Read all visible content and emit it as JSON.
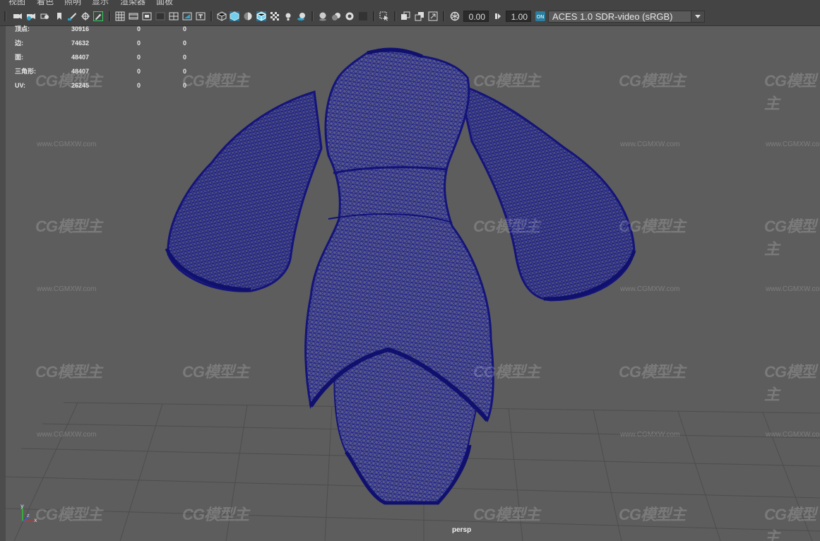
{
  "menubar": {
    "items": [
      "视图",
      "着色",
      "照明",
      "显示",
      "渲染器",
      "面板"
    ]
  },
  "toolbar": {
    "exposure_value": "0.00",
    "gamma_value": "1.00",
    "colorspace_value": "ACES 1.0 SDR-video (sRGB)",
    "icons": [
      "select-camera-icon",
      "camera-attributes-icon",
      "bookmark-icon",
      "image-plane-icon",
      "grease-pencil-icon",
      "grid-icon",
      "film-gate-icon",
      "resolution-gate-icon",
      "gate-mask-icon",
      "field-chart-icon",
      "safe-action-icon",
      "safe-title-icon",
      "wireframe-icon",
      "smooth-shade-icon",
      "wireframe-on-shaded-icon",
      "textured-icon",
      "lighting-icon",
      "shadows-icon",
      "ambient-occlusion-icon",
      "motion-blur-icon",
      "anti-aliasing-icon",
      "depth-of-field-icon",
      "isolate-select-icon",
      "xray-icon",
      "xray-joints-icon",
      "xray-active-icon",
      "exposure-icon",
      "gamma-icon",
      "color-management-icon"
    ]
  },
  "hud": {
    "rows": [
      {
        "label": "顶点:",
        "total": "30916",
        "selected": "0",
        "uv": "0"
      },
      {
        "label": "边:",
        "total": "74632",
        "selected": "0",
        "uv": "0"
      },
      {
        "label": "面:",
        "total": "48407",
        "selected": "0",
        "uv": "0"
      },
      {
        "label": "三角形:",
        "total": "48407",
        "selected": "0",
        "uv": "0"
      },
      {
        "label": "UV:",
        "total": "26245",
        "selected": "0",
        "uv": "0"
      }
    ]
  },
  "viewport": {
    "camera_label": "persp",
    "watermark_logo": "CG模型主",
    "watermark_url": "www.CGMXW.com",
    "axis_labels": [
      "y",
      "x",
      "z"
    ]
  },
  "colors": {
    "wireframe": "#1a1a8c",
    "background": "#5d5d5d",
    "grid": "#4a4a4a",
    "highlight_icon": "#2ea3c9"
  }
}
